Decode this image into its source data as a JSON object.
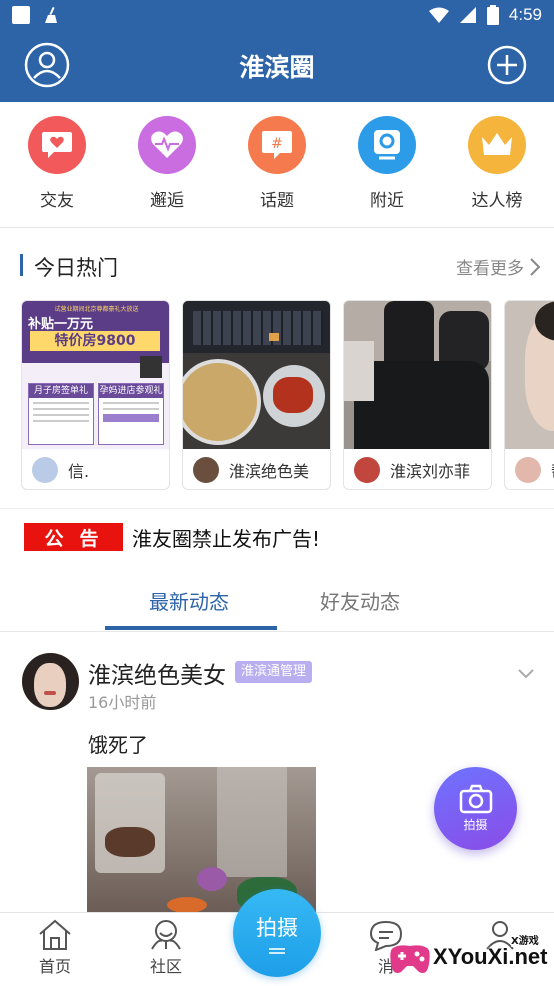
{
  "status_bar": {
    "time": "4:59"
  },
  "header": {
    "title": "淮滨圈"
  },
  "quick_nav": [
    {
      "label": "交友",
      "icon": "heart-chat-icon",
      "color": "#f2595a"
    },
    {
      "label": "邂逅",
      "icon": "heartbeat-icon",
      "color": "#c96de0"
    },
    {
      "label": "话题",
      "icon": "hashtag-icon",
      "color": "#f57b4e"
    },
    {
      "label": "附近",
      "icon": "location-icon",
      "color": "#2c9be8"
    },
    {
      "label": "达人榜",
      "icon": "crown-icon",
      "color": "#f5b43b"
    }
  ],
  "hot": {
    "title": "今日热门",
    "more": "查看更多",
    "cards": [
      {
        "name": "信.",
        "thumb": "promo-poster"
      },
      {
        "name": "淮滨绝色美",
        "thumb": "food-photo"
      },
      {
        "name": "淮滨刘亦菲",
        "thumb": "outfit-photo"
      },
      {
        "name": "帮",
        "thumb": "portrait-photo"
      }
    ],
    "poster": {
      "line1": "试营业期间北京尊都豪礼大放送",
      "line2": "补贴一万元",
      "line3": "特价房9800",
      "box1": "月子房签单礼",
      "box2": "孕妈进店参观礼"
    }
  },
  "notice": {
    "badge": "公告",
    "text": "淮友圈禁止发布广告!"
  },
  "tabs": {
    "active": "最新动态",
    "inactive": "好友动态"
  },
  "post": {
    "author": "淮滨绝色美女",
    "role": "淮滨通管理",
    "time": "16小时前",
    "text": "饿死了"
  },
  "fab": {
    "label": "拍摄"
  },
  "bottom_nav": {
    "home": "首页",
    "community": "社区",
    "shoot": "拍摄",
    "messages": "消"
  },
  "watermark": {
    "text": "XYouXi.net",
    "small": "X游戏"
  }
}
